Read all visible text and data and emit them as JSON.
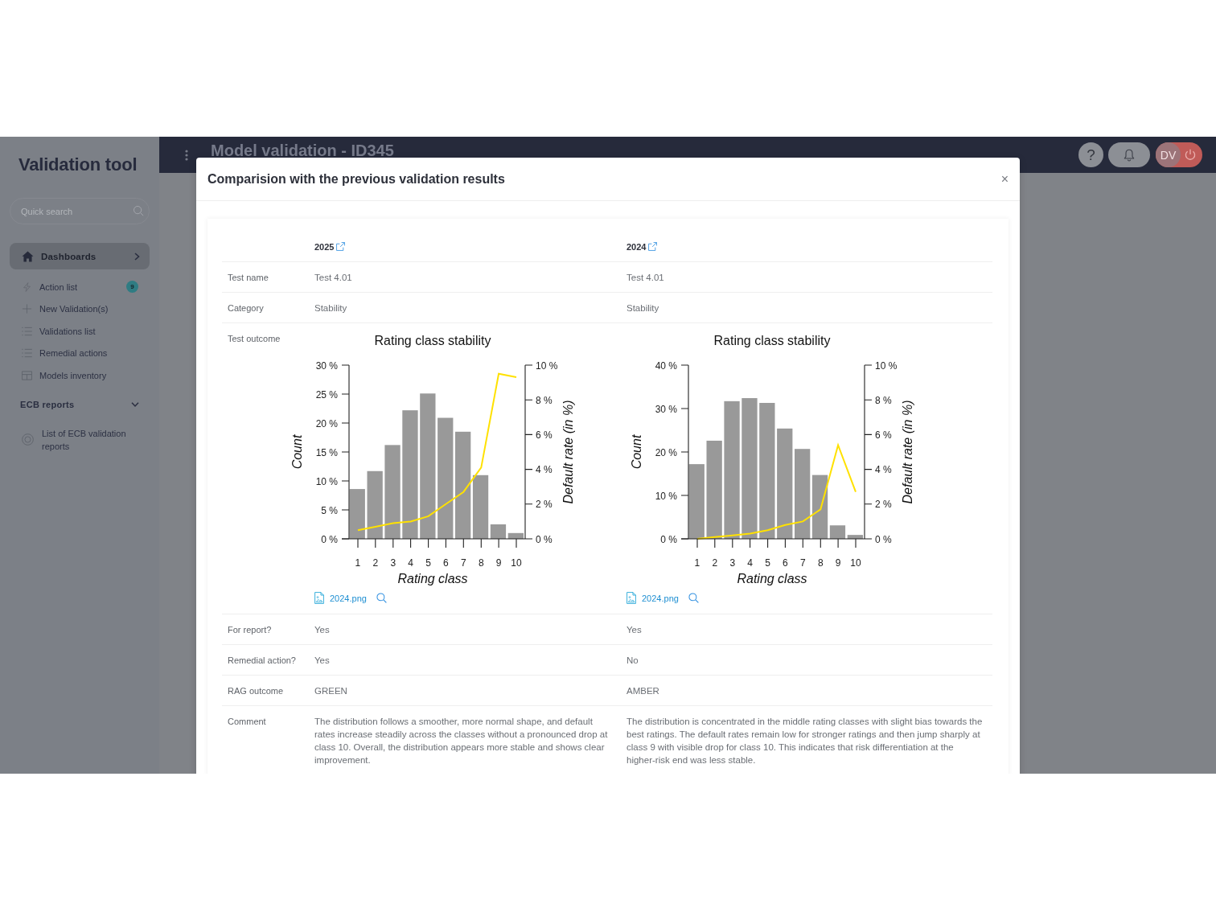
{
  "sidebar": {
    "title": "Validation tool",
    "search": {
      "placeholder": "Quick search"
    },
    "items": [
      {
        "label": "Dashboards",
        "kind": "group",
        "selected": true,
        "expanded": false
      },
      {
        "label": "Action list",
        "kind": "link",
        "selected": false,
        "badge": "9"
      },
      {
        "label": "New Validation(s)",
        "kind": "link",
        "selected": false
      },
      {
        "label": "Validations list",
        "kind": "link",
        "selected": false
      },
      {
        "label": "Remedial actions",
        "kind": "link",
        "selected": false
      },
      {
        "label": "Models inventory",
        "kind": "link",
        "selected": false
      }
    ],
    "sections": [
      {
        "title": "ECB reports",
        "expanded": true,
        "items": [
          {
            "label": "List of ECB validation reports",
            "selected": false
          }
        ]
      }
    ]
  },
  "header": {
    "title": "Model validation - ID345",
    "help": "?",
    "avatar": "DV"
  },
  "modal": {
    "title": "Comparision with the previous validation results",
    "close": "×",
    "columns": [
      {
        "label": "2025"
      },
      {
        "label": "2024"
      }
    ],
    "rows": [
      {
        "kind": "text",
        "label": "Test name",
        "values": [
          "Test 4.01",
          "Test 4.01"
        ]
      },
      {
        "kind": "text",
        "label": "Category",
        "values": [
          "Stability",
          "Stability"
        ]
      },
      {
        "kind": "chart",
        "label": "Test outcome",
        "charts": [
          {
            "attachment": "2024.png",
            "chart_data": {
              "type": "bar",
              "title": "Rating class stability",
              "xlabel": "Rating class",
              "ylabel": "Count",
              "y2label": "Default rate (in %)",
              "categories": [
                "1",
                "2",
                "3",
                "4",
                "5",
                "6",
                "7",
                "8",
                "9",
                "10"
              ],
              "series": [
                {
                  "type": "bar",
                  "color": "#999999",
                  "values": [
                    8.6,
                    11.7,
                    16.2,
                    22.2,
                    25.1,
                    20.9,
                    18.5,
                    11.0,
                    2.5,
                    1.0
                  ]
                },
                {
                  "type": "line",
                  "axis": "y2",
                  "color": "#ffe100",
                  "values": [
                    0.5,
                    0.7,
                    0.9,
                    1.0,
                    1.3,
                    2.0,
                    2.7,
                    4.1,
                    9.5,
                    9.3
                  ]
                }
              ],
              "ylim": [
                0,
                30
              ],
              "y2lim": [
                0,
                10
              ],
              "yticks": [
                {
                  "value": 0,
                  "label": "0 %"
                },
                {
                  "value": 5,
                  "label": "5 %"
                },
                {
                  "value": 10,
                  "label": "10 %"
                },
                {
                  "value": 15,
                  "label": "15 %"
                },
                {
                  "value": 20,
                  "label": "20 %"
                },
                {
                  "value": 25,
                  "label": "25 %"
                },
                {
                  "value": 30,
                  "label": "30 %"
                }
              ],
              "y2ticks": [
                {
                  "value": 0,
                  "label": "0 %"
                },
                {
                  "value": 2,
                  "label": "2 %"
                },
                {
                  "value": 4,
                  "label": "4 %"
                },
                {
                  "value": 6,
                  "label": "6 %"
                },
                {
                  "value": 8,
                  "label": "8 %"
                },
                {
                  "value": 10,
                  "label": "10 %"
                }
              ]
            }
          },
          {
            "attachment": "2024.png",
            "chart_data": {
              "type": "bar",
              "title": "Rating class stability",
              "xlabel": "Rating class",
              "ylabel": "Count",
              "y2label": "Default rate (in %)",
              "categories": [
                "1",
                "2",
                "3",
                "4",
                "5",
                "6",
                "7",
                "8",
                "9",
                "10"
              ],
              "series": [
                {
                  "type": "bar",
                  "color": "#999999",
                  "values": [
                    17.2,
                    22.6,
                    31.7,
                    32.4,
                    31.3,
                    25.4,
                    20.7,
                    14.7,
                    3.1,
                    0.9
                  ]
                },
                {
                  "type": "line",
                  "axis": "y2",
                  "color": "#ffe100",
                  "values": [
                    0,
                    0.1,
                    0.2,
                    0.3,
                    0.5,
                    0.8,
                    1.0,
                    1.7,
                    5.4,
                    2.7
                  ]
                }
              ],
              "ylim": [
                0,
                40
              ],
              "y2lim": [
                0,
                10
              ],
              "yticks": [
                {
                  "value": 0,
                  "label": "0 %"
                },
                {
                  "value": 10,
                  "label": "10 %"
                },
                {
                  "value": 20,
                  "label": "20 %"
                },
                {
                  "value": 30,
                  "label": "30 %"
                },
                {
                  "value": 40,
                  "label": "40 %"
                }
              ],
              "y2ticks": [
                {
                  "value": 0,
                  "label": "0 %"
                },
                {
                  "value": 2,
                  "label": "2 %"
                },
                {
                  "value": 4,
                  "label": "4 %"
                },
                {
                  "value": 6,
                  "label": "6 %"
                },
                {
                  "value": 8,
                  "label": "8 %"
                },
                {
                  "value": 10,
                  "label": "10 %"
                }
              ]
            }
          }
        ]
      },
      {
        "kind": "text",
        "label": "For report?",
        "values": [
          "Yes",
          "Yes"
        ]
      },
      {
        "kind": "text",
        "label": "Remedial action?",
        "values": [
          "Yes",
          "No"
        ]
      },
      {
        "kind": "text",
        "label": "RAG outcome",
        "values": [
          "GREEN",
          "AMBER"
        ]
      },
      {
        "kind": "text",
        "label": "Comment",
        "values": [
          "The distribution follows a smoother, more normal shape, and default rates increase steadily across the classes without a pronounced drop at class 10. Overall, the distribution appears more stable and shows clear improvement.",
          "The distribution is concentrated in the middle rating classes with slight bias towards the best ratings. The default rates remain low for stronger ratings and then jump sharply at class 9 with visible drop for class 10. This indicates that risk differentiation at the higher-risk end was less stable."
        ]
      }
    ]
  }
}
